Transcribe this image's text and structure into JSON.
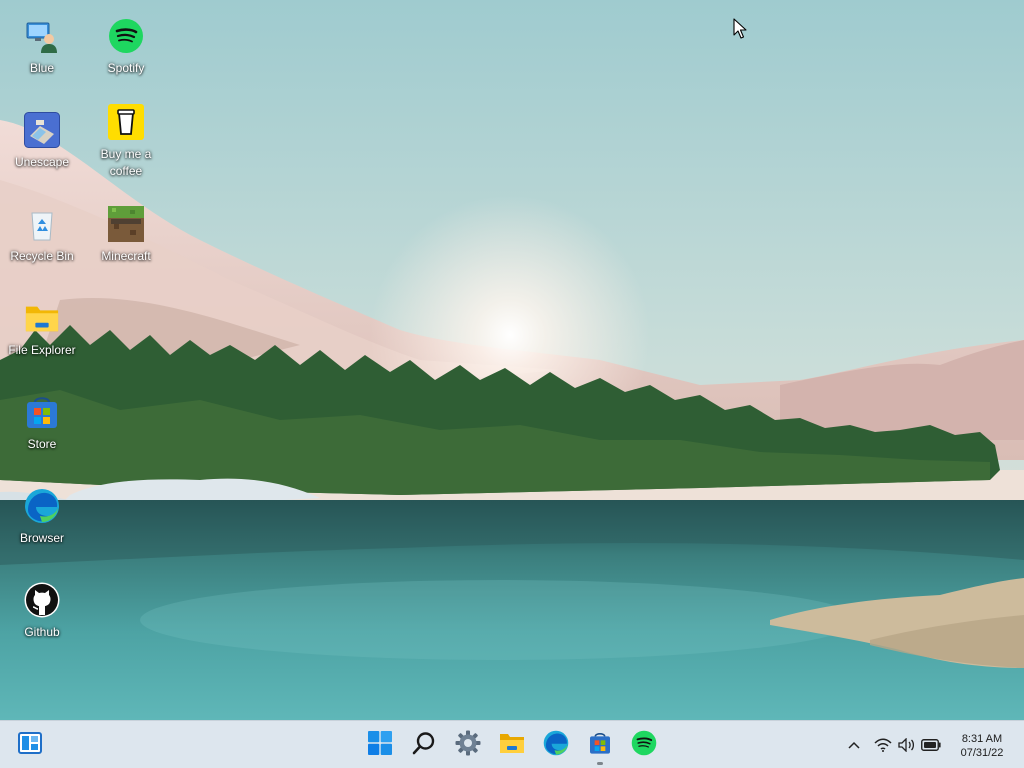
{
  "desktop": {
    "icons": [
      {
        "label": "Blue",
        "icon": "user-computer-icon"
      },
      {
        "label": "Spotify",
        "icon": "spotify-icon"
      },
      {
        "label": "Unescape",
        "icon": "unescape-game-icon"
      },
      {
        "label": "Buy me a coffee",
        "icon": "coffee-cup-icon"
      },
      {
        "label": "Recycle Bin",
        "icon": "recycle-bin-icon"
      },
      {
        "label": "Minecraft",
        "icon": "minecraft-icon"
      },
      {
        "label": "File Explorer",
        "icon": "folder-icon"
      },
      {
        "label": "Store",
        "icon": "store-icon"
      },
      {
        "label": "Browser",
        "icon": "edge-browser-icon"
      },
      {
        "label": "Github",
        "icon": "github-icon"
      }
    ]
  },
  "taskbar": {
    "widgets_icon": "widgets-icon",
    "apps": [
      {
        "name": "start",
        "icon": "windows-start-icon",
        "active": false
      },
      {
        "name": "search",
        "icon": "search-icon",
        "active": false
      },
      {
        "name": "settings",
        "icon": "gear-icon",
        "active": false
      },
      {
        "name": "file-explorer",
        "icon": "folder-icon",
        "active": false
      },
      {
        "name": "browser",
        "icon": "edge-browser-icon",
        "active": false
      },
      {
        "name": "store",
        "icon": "store-icon",
        "active": true
      },
      {
        "name": "spotify",
        "icon": "spotify-icon",
        "active": false
      }
    ],
    "tray": {
      "icons": [
        "chevron-up-icon",
        "wifi-icon",
        "volume-icon",
        "battery-icon"
      ],
      "time": "8:31 AM",
      "date": "07/31/22"
    }
  },
  "colors": {
    "taskbar_bg": "#dde6ee",
    "spotify_green": "#1ed760",
    "windows_blue": "#0f7ee6",
    "sky": "#a7cfd2",
    "water": "#2e8a8a"
  }
}
